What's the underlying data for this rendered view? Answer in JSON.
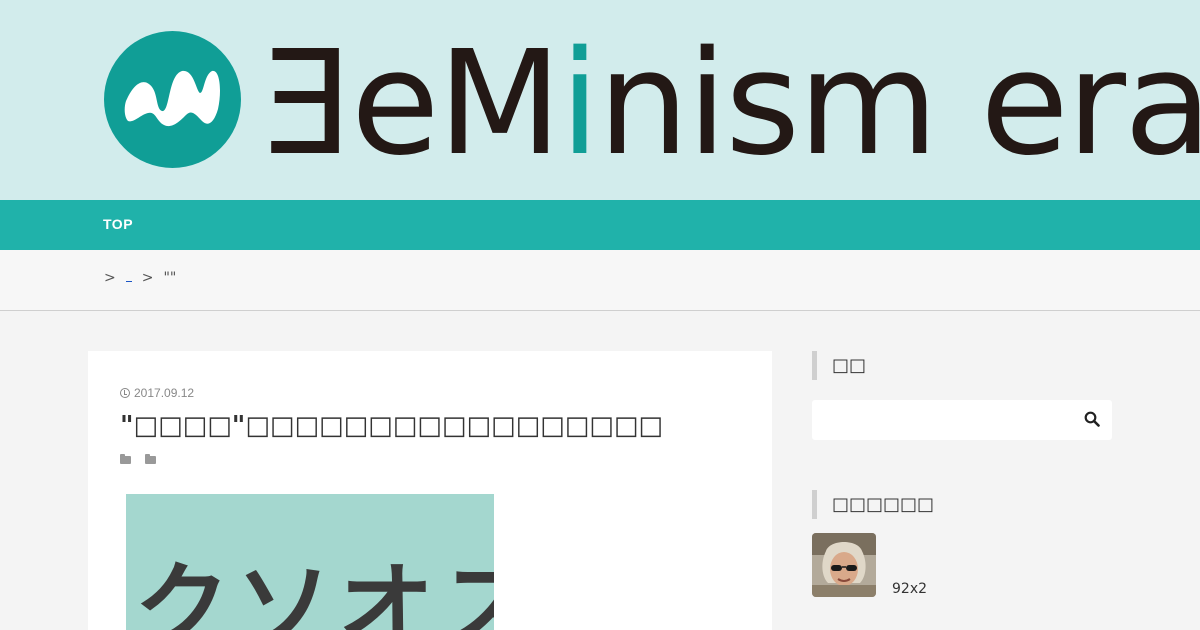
{
  "header": {
    "logo_text_part1": "ƎeM",
    "logo_text_i": "i",
    "logo_text_part2": "nism",
    "logo_text_part3": "era",
    "logo_color": "#109e96"
  },
  "nav": {
    "items": [
      {
        "label": "TOP"
      }
    ]
  },
  "breadcrumb": {
    "sep1": ">",
    "link1": "",
    "sep2": ">",
    "current": "\"\""
  },
  "article": {
    "date": "2017.09.12",
    "title": "\"□□□□\"□□□□□□□□□□□□□□□□□",
    "category_icons": [
      "folder-icon",
      "folder-icon"
    ],
    "thumbnail_text": "クソオス"
  },
  "sidebar": {
    "search_title": "□□",
    "search_placeholder": "",
    "popular_title": "□□□□□□",
    "popular_items": [
      {
        "text": "92x2"
      }
    ]
  },
  "colors": {
    "header_bg": "#d2ecec",
    "nav_bg": "#20b2aa",
    "thumb_bg": "#a4d7cf"
  }
}
